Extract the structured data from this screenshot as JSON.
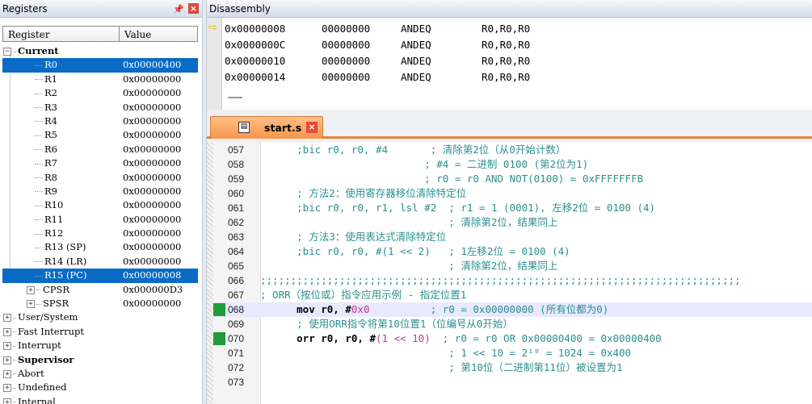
{
  "registers_panel": {
    "title": "Registers",
    "pin_icon": "📌",
    "close_label": "×",
    "col_register": "Register",
    "col_value": "Value",
    "rows": [
      {
        "name": "Current",
        "value": "",
        "kind": "group-open",
        "bold": true
      },
      {
        "name": "R0",
        "value": "0x00000400",
        "kind": "reg",
        "selected": true
      },
      {
        "name": "R1",
        "value": "0x00000000",
        "kind": "reg"
      },
      {
        "name": "R2",
        "value": "0x00000000",
        "kind": "reg"
      },
      {
        "name": "R3",
        "value": "0x00000000",
        "kind": "reg"
      },
      {
        "name": "R4",
        "value": "0x00000000",
        "kind": "reg"
      },
      {
        "name": "R5",
        "value": "0x00000000",
        "kind": "reg"
      },
      {
        "name": "R6",
        "value": "0x00000000",
        "kind": "reg"
      },
      {
        "name": "R7",
        "value": "0x00000000",
        "kind": "reg"
      },
      {
        "name": "R8",
        "value": "0x00000000",
        "kind": "reg"
      },
      {
        "name": "R9",
        "value": "0x00000000",
        "kind": "reg"
      },
      {
        "name": "R10",
        "value": "0x00000000",
        "kind": "reg"
      },
      {
        "name": "R11",
        "value": "0x00000000",
        "kind": "reg"
      },
      {
        "name": "R12",
        "value": "0x00000000",
        "kind": "reg"
      },
      {
        "name": "R13 (SP)",
        "value": "0x00000000",
        "kind": "reg"
      },
      {
        "name": "R14 (LR)",
        "value": "0x00000000",
        "kind": "reg"
      },
      {
        "name": "R15 (PC)",
        "value": "0x00000008",
        "kind": "reg",
        "selected": true
      },
      {
        "name": "CPSR",
        "value": "0x000000D3",
        "kind": "subgroup"
      },
      {
        "name": "SPSR",
        "value": "0x00000000",
        "kind": "subgroup"
      },
      {
        "name": "User/System",
        "value": "",
        "kind": "group"
      },
      {
        "name": "Fast Interrupt",
        "value": "",
        "kind": "group"
      },
      {
        "name": "Interrupt",
        "value": "",
        "kind": "group"
      },
      {
        "name": "Supervisor",
        "value": "",
        "kind": "group",
        "bold": true
      },
      {
        "name": "Abort",
        "value": "",
        "kind": "group"
      },
      {
        "name": "Undefined",
        "value": "",
        "kind": "group"
      },
      {
        "name": "Internal",
        "value": "",
        "kind": "group"
      }
    ]
  },
  "disassembly": {
    "title": "Disassembly",
    "arrow_icon": "⇨",
    "rows": [
      {
        "addr": "0x00000008",
        "opcode": "00000000",
        "mnemonic": "ANDEQ",
        "operands": "R0,R0,R0"
      },
      {
        "addr": "0x0000000C",
        "opcode": "00000000",
        "mnemonic": "ANDEQ",
        "operands": "R0,R0,R0"
      },
      {
        "addr": "0x00000010",
        "opcode": "00000000",
        "mnemonic": "ANDEQ",
        "operands": "R0,R0,R0"
      },
      {
        "addr": "0x00000014",
        "opcode": "00000000",
        "mnemonic": "ANDEQ",
        "operands": "R0,R0,R0"
      }
    ]
  },
  "editor": {
    "tab_title": "start.s",
    "tab_close": "×",
    "file_icon": "▤",
    "lines": [
      {
        "num": "057",
        "parts": [
          {
            "t": "      ;bic r0, r0, #4       ; 清除第2位（从0开始计数）",
            "c": "cm"
          }
        ]
      },
      {
        "num": "058",
        "parts": [
          {
            "t": "                           ; #4 = 二进制 0100 (第2位为1)",
            "c": "cm"
          }
        ]
      },
      {
        "num": "059",
        "parts": [
          {
            "t": "                           ; r0 = r0 AND NOT(0100) = 0xFFFFFFFB",
            "c": "cm"
          }
        ]
      },
      {
        "num": "060",
        "parts": [
          {
            "t": "      ; 方法2：使用寄存器移位清除特定位",
            "c": "cm"
          }
        ]
      },
      {
        "num": "061",
        "parts": [
          {
            "t": "      ;bic r0, r0, r1, lsl #2  ; r1 = 1 (0001), 左移2位 = 0100 (4)",
            "c": "cm"
          }
        ]
      },
      {
        "num": "062",
        "parts": [
          {
            "t": "                               ; 清除第2位，结果同上",
            "c": "cm"
          }
        ]
      },
      {
        "num": "063",
        "parts": [
          {
            "t": "      ; 方法3：使用表达式清除特定位",
            "c": "cm"
          }
        ]
      },
      {
        "num": "064",
        "parts": [
          {
            "t": "      ;bic r0, r0, #(1 << 2)   ; 1左移2位 = 0100 (4)",
            "c": "cm"
          }
        ]
      },
      {
        "num": "065",
        "parts": [
          {
            "t": "                               ; 清除第2位，结果同上",
            "c": "cm"
          }
        ]
      },
      {
        "num": "066",
        "parts": [
          {
            "t": ";;;;;;;;;;;;;;;;;;;;;;;;;;;;;;;;;;;;;;;;;;;;;;;;;;;;;;;;;;;;;;;;;;;;;;;;;;;;;;;",
            "c": "cm"
          }
        ]
      },
      {
        "num": "067",
        "parts": [
          {
            "t": "; ORR（按位或）指令应用示例 - 指定位置1",
            "c": "cm"
          }
        ]
      },
      {
        "num": "068",
        "bp": true,
        "hl": true,
        "parts": [
          {
            "t": "      mov r0, #",
            "c": "kw"
          },
          {
            "t": "0x0",
            "c": "num"
          },
          {
            "t": "          ; r0 = 0x00000000 (所有位都为0)",
            "c": "cm"
          }
        ]
      },
      {
        "num": "069",
        "parts": [
          {
            "t": "      ; 使用ORR指令将第10位置1（位编号从0开始）",
            "c": "cm"
          }
        ]
      },
      {
        "num": "070",
        "bp": true,
        "parts": [
          {
            "t": "      orr r0, r0, #",
            "c": "kw"
          },
          {
            "t": "(1 << 10)",
            "c": "num"
          },
          {
            "t": "  ; r0 = r0 OR 0x00000400 = 0x00000400",
            "c": "cm"
          }
        ]
      },
      {
        "num": "071",
        "parts": [
          {
            "t": "                               ; 1 << 10 = 2¹⁰ = 1024 = 0x400",
            "c": "cm"
          }
        ]
      },
      {
        "num": "072",
        "parts": [
          {
            "t": "                               ; 第10位（二进制第11位）被设置为1",
            "c": "cm"
          }
        ]
      },
      {
        "num": "073",
        "parts": [
          {
            "t": "",
            "c": "cm"
          }
        ]
      }
    ]
  }
}
